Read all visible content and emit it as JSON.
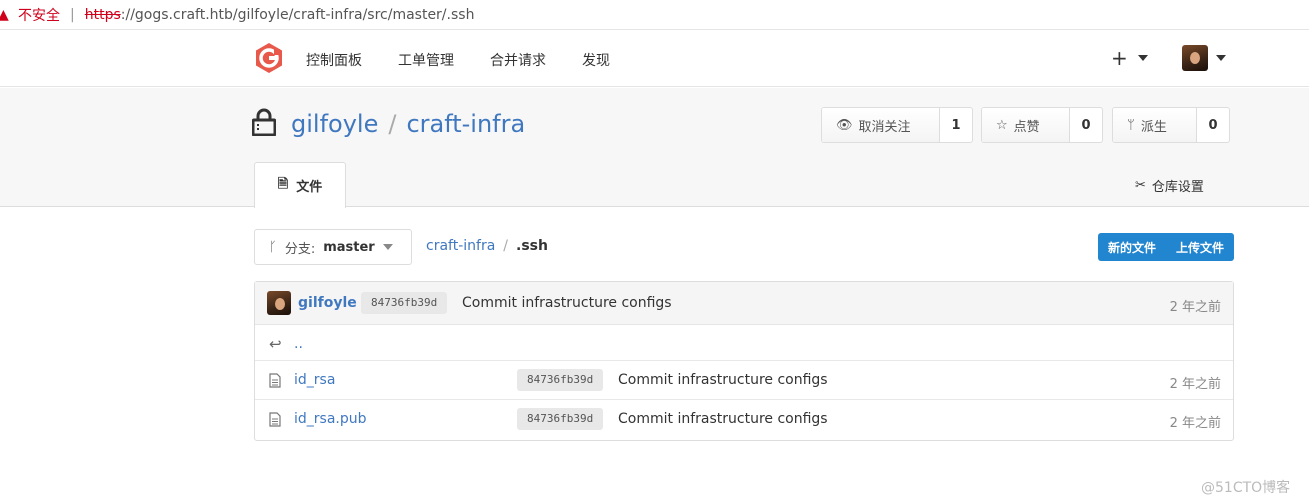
{
  "browser": {
    "insecure_label": "不安全",
    "url_scheme": "https",
    "url_rest": "://gogs.craft.htb/gilfoyle/craft-infra/src/master/.ssh"
  },
  "nav": {
    "items": [
      "控制面板",
      "工单管理",
      "合并请求",
      "发现"
    ],
    "plus": "+"
  },
  "repo": {
    "owner": "gilfoyle",
    "separator": "/",
    "name": "craft-infra",
    "watch_label": "取消关注",
    "watch_count": "1",
    "star_label": "点赞",
    "star_count": "0",
    "fork_label": "派生",
    "fork_count": "0"
  },
  "tabs": {
    "files": "文件",
    "settings": "仓库设置"
  },
  "branch": {
    "prefix": "分支:",
    "name": "master"
  },
  "path": {
    "root": "craft-infra",
    "separator": "/",
    "current": ".ssh"
  },
  "actions": {
    "new_file": "新的文件",
    "upload_file": "上传文件"
  },
  "latest_commit": {
    "author": "gilfoyle",
    "sha": "84736fb39d",
    "message": "Commit infrastructure configs",
    "time": "2 年之前"
  },
  "files": {
    "parent": "..",
    "rows": [
      {
        "name": "id_rsa",
        "sha": "84736fb39d",
        "message": "Commit infrastructure configs",
        "time": "2 年之前"
      },
      {
        "name": "id_rsa.pub",
        "sha": "84736fb39d",
        "message": "Commit infrastructure configs",
        "time": "2 年之前"
      }
    ]
  },
  "watermark": "@51CTO博客",
  "colors": {
    "link": "#4078c0",
    "primary_button": "#2185d0",
    "logo": "#e8594b",
    "insecure": "#d0021b"
  }
}
